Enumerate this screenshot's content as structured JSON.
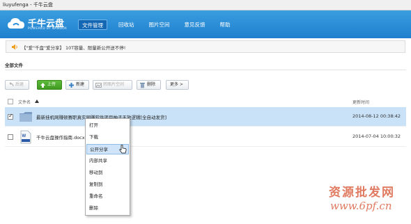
{
  "window": {
    "title": "liuyufenga - 千牛云盘"
  },
  "header": {
    "logo_text": "千牛云盘",
    "logo_sub": "POWERED BY NANDOX",
    "nav": [
      {
        "label": "文件管理",
        "active": true
      },
      {
        "label": "回收站"
      },
      {
        "label": "图片空间"
      },
      {
        "label": "意见反馈"
      },
      {
        "label": "帮助"
      }
    ]
  },
  "notice": {
    "text": "【\"爱\"千盘\"爱分享】 10T容量、限量新公开送不停!"
  },
  "section": {
    "title": "全部文件"
  },
  "toolbar": {
    "back": "后退",
    "upload": "上传",
    "new": "新建",
    "to_image_space": "转图片空间",
    "delete": "删除",
    "more": "更多 >"
  },
  "list": {
    "col_name": "文件名",
    "col_time": "更新时间",
    "rows": [
      {
        "name": "最新挂机网赚顿赛职真实网赚软件项目柚子无放逻辑[全自动发货]",
        "time": "2014-08-12 00:38:42",
        "selected": true
      },
      {
        "name": "千牛云盘操作指南.docx",
        "time": "2014-07-04 10:00:32",
        "selected": false
      }
    ]
  },
  "context_menu": {
    "items": [
      {
        "label": "打开"
      },
      {
        "label": "下载"
      },
      {
        "label": "公开分享",
        "hover": true
      },
      {
        "label": "内部共享"
      },
      {
        "label": "移动到"
      },
      {
        "label": "复制到"
      },
      {
        "label": "重命名"
      },
      {
        "label": "删除"
      }
    ]
  },
  "watermark": {
    "text": "资源批发网",
    "url": "www.6pf.cn"
  },
  "colors": {
    "header": "#2b8fd8",
    "accent": "#1467b2",
    "selected_row": "#c9e2f7",
    "upload": "#4aa52a",
    "watermark": "#e07a60"
  }
}
